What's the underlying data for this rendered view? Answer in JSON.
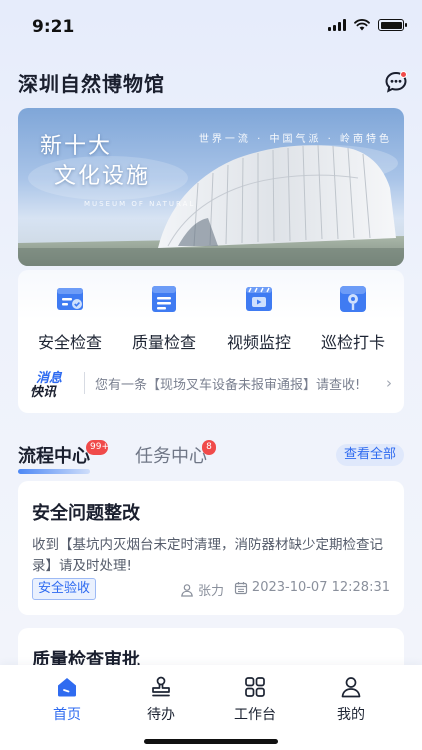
{
  "status_bar": {
    "time": "9:21"
  },
  "header": {
    "title": "深圳自然博物馆"
  },
  "banner": {
    "title_line1": "新十大",
    "title_line2": "文化设施",
    "subtitle": "世界一流 · 中国气派 · 岭南特色",
    "english": "MUSEUM OF NATURAL"
  },
  "quick_actions": [
    {
      "label": "安全检查",
      "icon": "safety-check-icon"
    },
    {
      "label": "质量检查",
      "icon": "quality-check-icon"
    },
    {
      "label": "视频监控",
      "icon": "video-monitor-icon"
    },
    {
      "label": "巡检打卡",
      "icon": "patrol-checkin-icon"
    }
  ],
  "notice": {
    "badge_line1": "消息",
    "badge_line2": "快讯",
    "text": "您有一条【现场叉车设备未报审通报】请查收!"
  },
  "tabs": {
    "items": [
      {
        "label": "流程中心",
        "badge": "99+",
        "active": true
      },
      {
        "label": "任务中心",
        "badge": "8",
        "active": false
      }
    ],
    "view_all": "查看全部"
  },
  "cards": [
    {
      "title": "安全问题整改",
      "description": "收到【基坑内灭烟台未定时清理，消防器材缺少定期检查记录】请及时处理!",
      "tag": "安全验收",
      "user": "张力",
      "time": "2023-10-07 12:28:31"
    },
    {
      "title": "质量检查审批"
    }
  ],
  "tab_bar": [
    {
      "label": "首页",
      "icon": "home-icon",
      "active": true
    },
    {
      "label": "待办",
      "icon": "stamp-icon",
      "active": false
    },
    {
      "label": "工作台",
      "icon": "grid-icon",
      "active": false
    },
    {
      "label": "我的",
      "icon": "user-icon",
      "active": false
    }
  ],
  "colors": {
    "accent": "#2f6bf0",
    "badge": "#f04a4a",
    "background": "#eef2fb"
  }
}
